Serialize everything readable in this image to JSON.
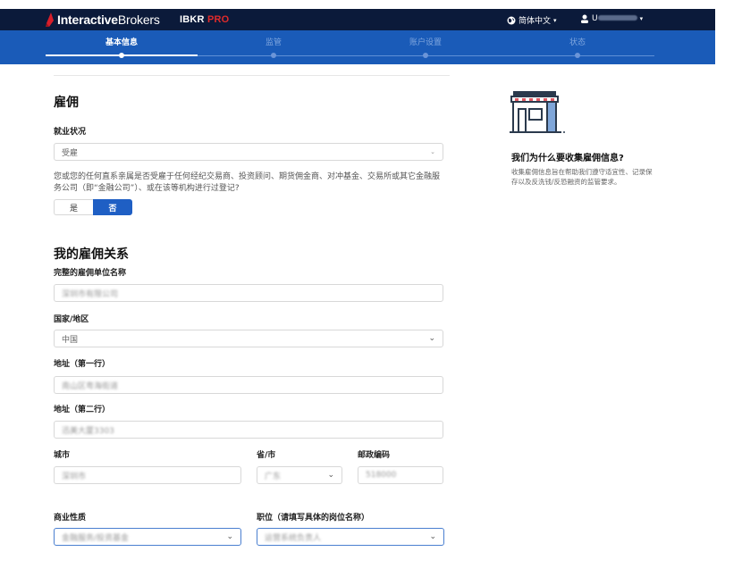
{
  "header": {
    "brand_bold": "Interactive",
    "brand_light": "Brokers",
    "product_ibkr": "IBKR",
    "product_pro": "PRO",
    "language": "简体中文",
    "user_prefix": "U"
  },
  "steps": [
    {
      "label": "基本信息",
      "active": true
    },
    {
      "label": "监管",
      "active": false
    },
    {
      "label": "账户设置",
      "active": false
    },
    {
      "label": "状态",
      "active": false
    }
  ],
  "employment": {
    "title": "雇佣",
    "status_label": "就业状况",
    "status_value": "受雇",
    "question": "您或您的任何直系亲属是否受雇于任何经纪交易商、投资顾问、期货佣金商、对冲基金、交易所或其它金融服务公司（即“金融公司”）、或在该等机构进行过登记?",
    "yes_label": "是",
    "no_label": "否",
    "selected": "否"
  },
  "relationship": {
    "title": "我的雇佣关系",
    "employer_label": "完整的雇佣单位名称",
    "employer_value": "深圳市有限公司",
    "country_label": "国家/地区",
    "country_value": "中国",
    "address1_label": "地址（第一行）",
    "address1_value": "南山区粤海街道",
    "address2_label": "地址（第二行）",
    "address2_value": "迅美大厦3303",
    "city_label": "城市",
    "city_value": "深圳市",
    "province_label": "省/市",
    "province_value": "广东",
    "postal_label": "邮政编码",
    "postal_value": "518000",
    "business_label": "商业性质",
    "business_value": "金融服务/投资基金",
    "position_label": "职位（请填写具体的岗位名称）",
    "position_value": "运营系统负责人"
  },
  "side": {
    "title": "我们为什么要收集雇佣信息?",
    "text": "收集雇佣信息旨在帮助我们遵守适宜性、记录保存以及反洗钱/反恐融资的监管要求。"
  },
  "colors": {
    "topbar": "#0b1a3a",
    "stepbar": "#1a5bb8",
    "accent": "#1f5fc4",
    "brand_red": "#e02b2b"
  }
}
